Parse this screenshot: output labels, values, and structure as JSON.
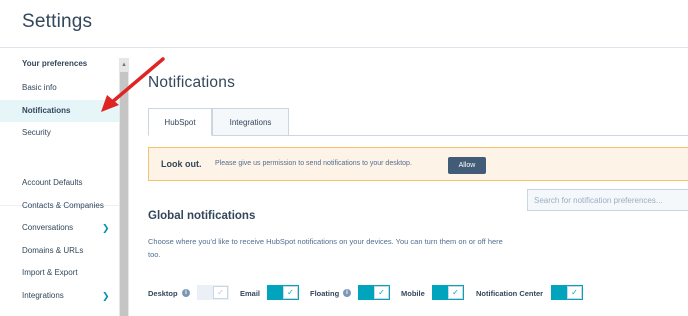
{
  "header": {
    "title": "Settings"
  },
  "sidebar": {
    "items": [
      {
        "label": "Your preferences"
      },
      {
        "label": "Basic info"
      },
      {
        "label": "Notifications"
      },
      {
        "label": "Security"
      },
      {
        "label": "Account Defaults"
      },
      {
        "label": "Contacts & Companies"
      },
      {
        "label": "Conversations"
      },
      {
        "label": "Domains & URLs"
      },
      {
        "label": "Import & Export"
      },
      {
        "label": "Integrations"
      }
    ],
    "active": "Notifications"
  },
  "main": {
    "title": "Notifications",
    "tabs": [
      {
        "label": "HubSpot",
        "selected": true
      },
      {
        "label": "Integrations",
        "selected": false
      }
    ],
    "alert": {
      "title": "Look out.",
      "text": "Please give us permission to send notifications to your desktop.",
      "button_label": "Allow"
    },
    "search": {
      "placeholder": "Search for notification preferences..."
    },
    "section": {
      "title": "Global notifications",
      "description": "Choose where you'd like to receive HubSpot notifications on your devices. You can turn them on or off here too."
    },
    "preferences": [
      {
        "label": "Desktop",
        "info": true,
        "enabled": false
      },
      {
        "label": "Email",
        "info": false,
        "enabled": true
      },
      {
        "label": "Floating",
        "info": true,
        "enabled": true
      },
      {
        "label": "Mobile",
        "info": false,
        "enabled": true
      },
      {
        "label": "Notification Center",
        "info": false,
        "enabled": true
      }
    ]
  },
  "icons": {
    "info": "info-icon",
    "check": "check-icon",
    "chevron": "chevron-down-icon",
    "annotation": "red-arrow-annotation"
  },
  "colors": {
    "accent": "#00a4bd",
    "alert_bg": "#fdf3e7",
    "alert_border": "#f5c26b",
    "button": "#425b76",
    "annotation": "#e02424"
  }
}
